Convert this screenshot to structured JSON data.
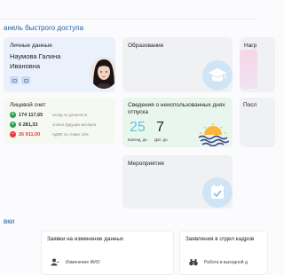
{
  "sections": {
    "quick_access": "анель быстрого доступа",
    "applications": "вки"
  },
  "personal": {
    "label": "Личные данные",
    "name_line1": "Наумова Галина",
    "name_line2": "Ивановна"
  },
  "education": {
    "label": "Образование"
  },
  "rewards": {
    "label": "Нагр"
  },
  "account": {
    "label": "Лицевой счет",
    "rows": [
      {
        "sign": "+",
        "value": "174 117,65",
        "note": "оклад по должности",
        "color": "#2e9e4f"
      },
      {
        "sign": "+",
        "value": "6 281,33",
        "note": "оплата будущих месяцев",
        "color": "#2e9e4f"
      },
      {
        "sign": "−",
        "value": "26 911,00",
        "note": "НДФЛ по ставке 13%",
        "color": "#e23b3b"
      }
    ]
  },
  "leave": {
    "label": "Сведения о неиспользованных днях отпуска",
    "calendar_days": "25",
    "extra_days": "7",
    "calendar_label": "Календ. дн.",
    "extra_label": "Доп. дн."
  },
  "positions": {
    "label": "Посл"
  },
  "events": {
    "label": "Мероприятия"
  },
  "applications": {
    "card1": {
      "title": "Заявки на изменение данных",
      "item": "Изменение ФИО"
    },
    "card2": {
      "title": "Заявления в отдел кадров",
      "item": "Работа в выходной д"
    }
  },
  "colors": {
    "accent": "#1f5ea8",
    "positive": "#2e9e4f",
    "negative": "#e23b3b"
  }
}
